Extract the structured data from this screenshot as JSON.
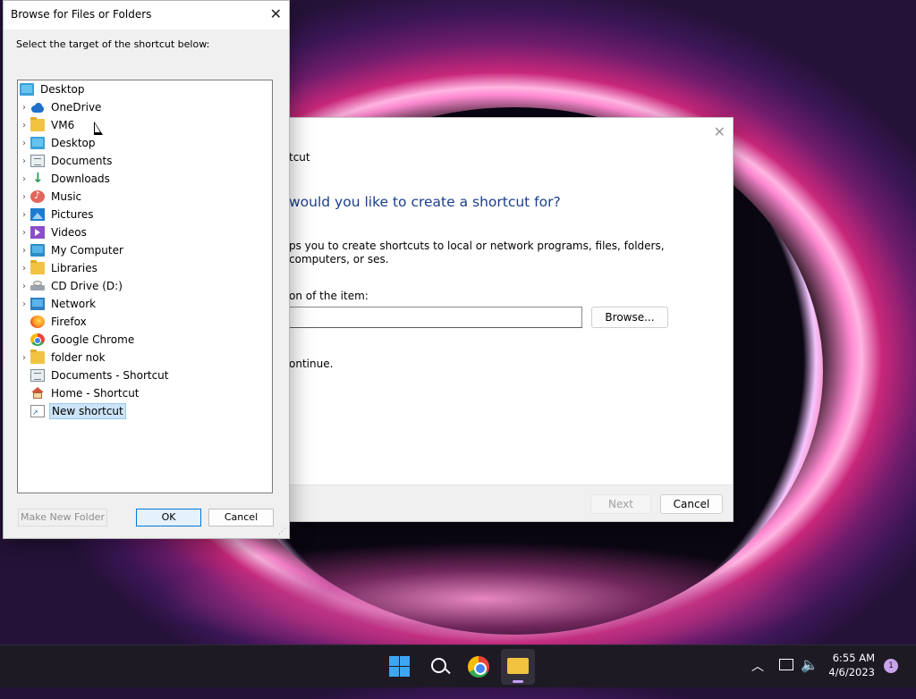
{
  "wizard": {
    "title": "tcut",
    "heading": "would you like to create a shortcut for?",
    "description": "ps you to create shortcuts to local or network programs, files, folders, computers, or ses.",
    "location_label": "on of the item:",
    "location_value": "",
    "browse_label": "Browse...",
    "continue_text": "ontinue.",
    "next_label": "Next",
    "cancel_label": "Cancel"
  },
  "browse_dialog": {
    "title": "Browse for Files or Folders",
    "instruction": "Select the target of the shortcut below:",
    "tree": [
      {
        "label": "Desktop",
        "icon": "desktop-icon",
        "expandable": false,
        "level": 0
      },
      {
        "label": "OneDrive",
        "icon": "cloud-icon",
        "expandable": true,
        "level": 1
      },
      {
        "label": "VM6",
        "icon": "folder-icon",
        "expandable": true,
        "level": 1
      },
      {
        "label": "Desktop",
        "icon": "desktop-icon",
        "expandable": true,
        "level": 1
      },
      {
        "label": "Documents",
        "icon": "documents-icon",
        "expandable": true,
        "level": 1
      },
      {
        "label": "Downloads",
        "icon": "download-icon",
        "expandable": true,
        "level": 1
      },
      {
        "label": "Music",
        "icon": "music-icon",
        "expandable": true,
        "level": 1
      },
      {
        "label": "Pictures",
        "icon": "pictures-icon",
        "expandable": true,
        "level": 1
      },
      {
        "label": "Videos",
        "icon": "videos-icon",
        "expandable": true,
        "level": 1
      },
      {
        "label": "My Computer",
        "icon": "computer-icon",
        "expandable": true,
        "level": 1
      },
      {
        "label": "Libraries",
        "icon": "folder-icon",
        "expandable": true,
        "level": 1
      },
      {
        "label": "CD Drive (D:)",
        "icon": "drive-icon",
        "expandable": true,
        "level": 1
      },
      {
        "label": "Network",
        "icon": "network-icon",
        "expandable": true,
        "level": 1
      },
      {
        "label": "Firefox",
        "icon": "firefox-icon",
        "expandable": false,
        "level": 1
      },
      {
        "label": "Google Chrome",
        "icon": "chrome-icon",
        "expandable": false,
        "level": 1
      },
      {
        "label": "folder nok",
        "icon": "folder-icon",
        "expandable": true,
        "level": 1
      },
      {
        "label": "Documents - Shortcut",
        "icon": "documents-icon",
        "expandable": false,
        "level": 1
      },
      {
        "label": "Home - Shortcut",
        "icon": "home-icon",
        "expandable": false,
        "level": 1
      },
      {
        "label": "New shortcut",
        "icon": "shortcut-icon",
        "expandable": false,
        "level": 1,
        "selected": true
      }
    ],
    "make_new_folder_label": "Make New Folder",
    "ok_label": "OK",
    "cancel_label": "Cancel"
  },
  "taskbar": {
    "apps": [
      "start-icon",
      "search-icon",
      "chrome-icon",
      "file-explorer-icon"
    ],
    "time": "6:55 AM",
    "date": "4/6/2023",
    "notification_count": "1"
  },
  "colors": {
    "accent": "#0078d7",
    "heading_blue": "#1b3d8c",
    "selection": "#cce4f7",
    "taskbar": "#1d1a24"
  }
}
